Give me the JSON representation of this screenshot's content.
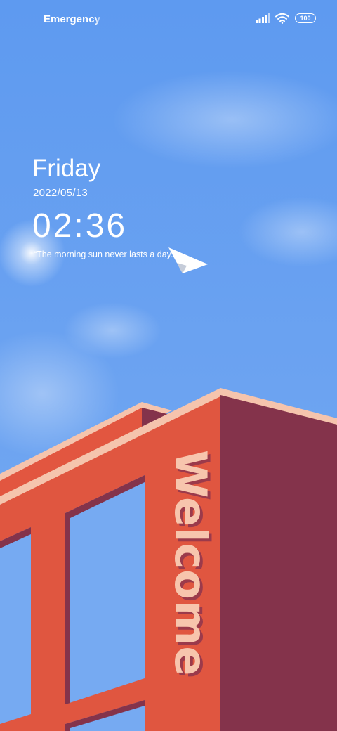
{
  "status_bar": {
    "carrier": "Emergency c",
    "battery": "100",
    "signal_icon": "signal-bars-icon",
    "wifi_icon": "wifi-icon"
  },
  "lockscreen": {
    "day": "Friday",
    "date": "2022/05/13",
    "time": "02:36",
    "quote": "“The morning sun never lasts a day.”"
  },
  "wallpaper": {
    "sign_text": "Welcome",
    "colors": {
      "sky_top": "#5e9af0",
      "sky_bottom": "#76aaf2",
      "building_front": "#e05640",
      "building_side": "#84334b",
      "building_trim": "#f5c4ad",
      "sign": "#f7c5ad"
    }
  }
}
